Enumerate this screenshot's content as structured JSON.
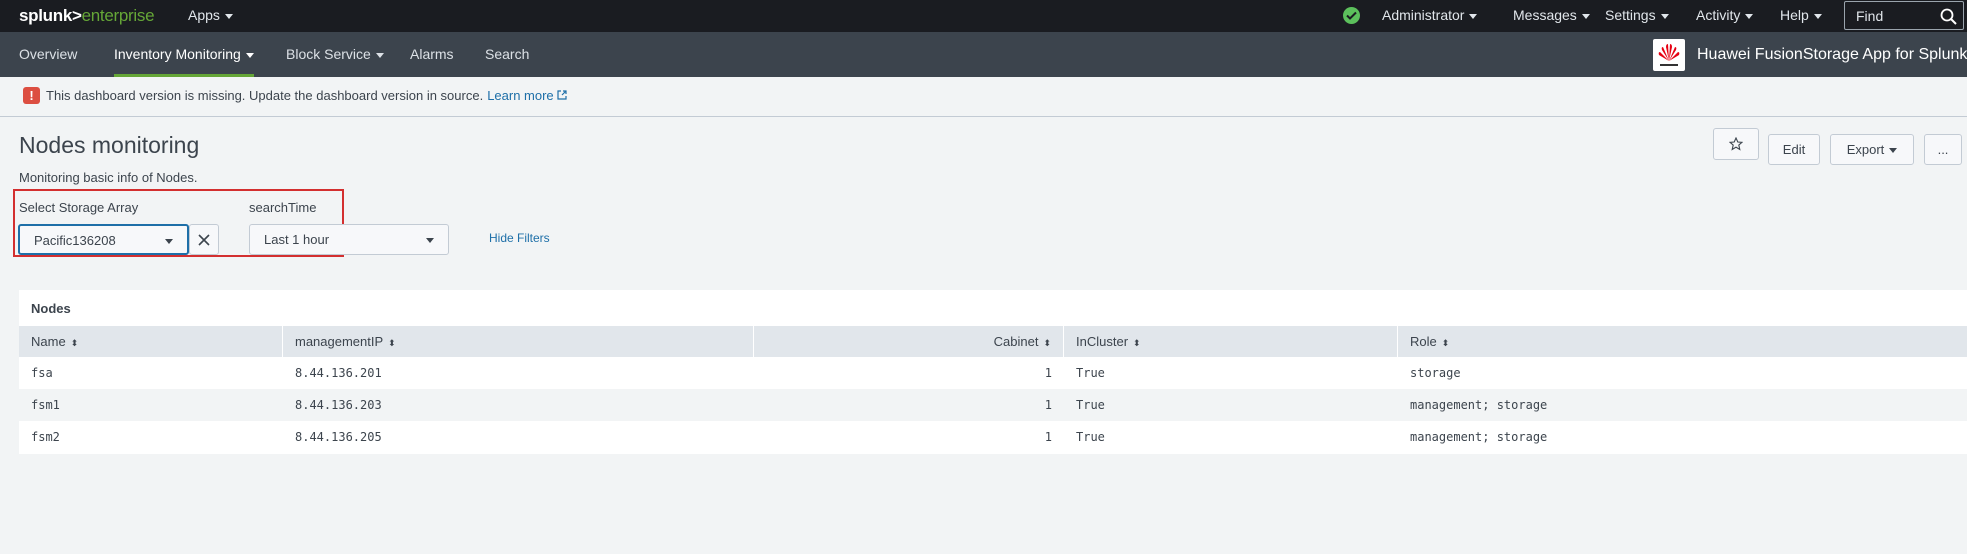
{
  "topbar": {
    "logo_bold": "splunk>",
    "logo_light": "enterprise",
    "apps": "Apps",
    "administrator": "Administrator",
    "messages": "Messages",
    "settings": "Settings",
    "activity": "Activity",
    "help": "Help",
    "find_placeholder": "Find"
  },
  "appnav": {
    "items": [
      "Overview",
      "Inventory Monitoring",
      "Block Service",
      "Alarms",
      "Search"
    ],
    "active": "Inventory Monitoring",
    "app_title": "Huawei FusionStorage App for Splunk",
    "brand_color": "#e60012"
  },
  "alert": {
    "text": "This dashboard version is missing. Update the dashboard version in source.",
    "link": "Learn more"
  },
  "dashboard": {
    "title": "Nodes monitoring",
    "description": "Monitoring basic info of Nodes.",
    "buttons": {
      "edit": "Edit",
      "export": "Export",
      "more": "..."
    }
  },
  "filters": {
    "storage_label": "Select Storage Array",
    "storage_value": "Pacific136208",
    "time_label": "searchTime",
    "time_value": "Last 1 hour",
    "hide": "Hide Filters"
  },
  "panel": {
    "title": "Nodes",
    "columns": [
      "Name",
      "managementIP",
      "Cabinet",
      "InCluster",
      "Role"
    ],
    "rows": [
      [
        "fsa",
        "8.44.136.201",
        "1",
        "True",
        "storage"
      ],
      [
        "fsm1",
        "8.44.136.203",
        "1",
        "True",
        "management; storage"
      ],
      [
        "fsm2",
        "8.44.136.205",
        "1",
        "True",
        "management; storage"
      ]
    ]
  },
  "colors": {
    "accent_green": "#65a637",
    "link_blue": "#1e6fa8",
    "alert_red": "#dc4e41",
    "highlight_red": "#d32f2f"
  }
}
